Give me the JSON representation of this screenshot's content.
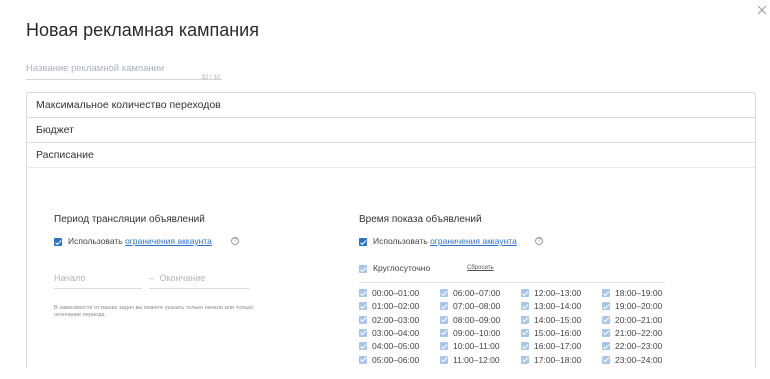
{
  "window": {
    "title": "Новая рекламная кампания"
  },
  "name_field": {
    "placeholder": "Название рекламной кампании",
    "counter": "32 / 32"
  },
  "sections": {
    "max_clicks": "Максимальное количество переходов",
    "budget": "Бюджет",
    "schedule": "Расписание"
  },
  "period": {
    "title": "Период трансляции объявлений",
    "use_label": "Использовать",
    "use_link": "ограничения аккаунта",
    "start_placeholder": "Начало",
    "dash": "–",
    "end_placeholder": "Окончание",
    "hint": "В зависимости от ваших задач вы можете указать только начало или только окончание периода."
  },
  "show_time": {
    "title": "Время показа объявлений",
    "use_label": "Использовать",
    "use_link": "ограничения аккаунта",
    "all_day_label": "Круглосуточно",
    "reset_label": "Сбросить",
    "slots": [
      "00:00–01:00",
      "01:00–02:00",
      "02:00–03:00",
      "03:00–04:00",
      "04:00–05:00",
      "05:00–06:00",
      "06:00–07:00",
      "07:00–08:00",
      "08:00–09:00",
      "09:00–10:00",
      "10:00–11:00",
      "11:00–12:00",
      "12:00–13:00",
      "13:00–14:00",
      "14:00–15:00",
      "15:00–16:00",
      "16:00–17:00",
      "17:00–18:00",
      "18:00–19:00",
      "19:00–20:00",
      "20:00–21:00",
      "21:00–22:00",
      "22:00–23:00",
      "23:00–24:00"
    ]
  },
  "icons": {
    "close": "close-icon",
    "help": "help-icon",
    "checkbox": "checkbox-checked-icon"
  },
  "colors": {
    "accent": "#2f72c4",
    "checkbox_disabled": "#a9c6e8",
    "border": "#d9d9d9"
  }
}
